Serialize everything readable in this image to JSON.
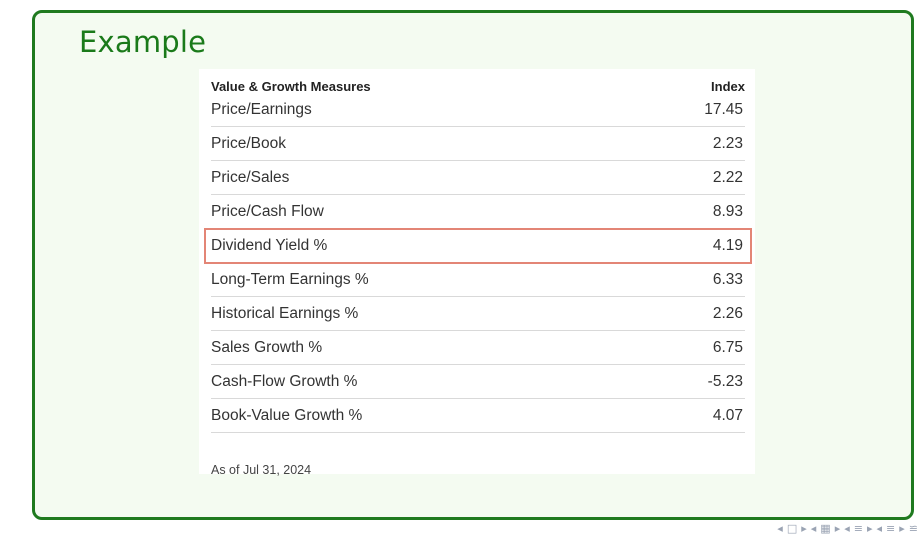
{
  "slide": {
    "title": "Example"
  },
  "table": {
    "header": {
      "label": "Value & Growth Measures",
      "value": "Index"
    },
    "rows": [
      {
        "label": "Price/Earnings",
        "value": "17.45"
      },
      {
        "label": "Price/Book",
        "value": "2.23"
      },
      {
        "label": "Price/Sales",
        "value": "2.22"
      },
      {
        "label": "Price/Cash Flow",
        "value": "8.93"
      },
      {
        "label": "Dividend Yield %",
        "value": "4.19"
      },
      {
        "label": "Long-Term Earnings %",
        "value": "6.33"
      },
      {
        "label": "Historical Earnings %",
        "value": "2.26"
      },
      {
        "label": "Sales Growth %",
        "value": "6.75"
      },
      {
        "label": "Cash-Flow Growth %",
        "value": "-5.23"
      },
      {
        "label": "Book-Value Growth %",
        "value": "4.07"
      }
    ],
    "highlighted_row": "Dividend Yield %",
    "footnote": "As of Jul 31, 2024"
  },
  "nav": {
    "icons": [
      "nav-prev-icon",
      "frame-icon",
      "nav-next-icon",
      "nav-prev-icon",
      "subsection-icon",
      "nav-next-icon",
      "nav-prev-icon",
      "section-icon",
      "nav-next-icon",
      "nav-prev-icon",
      "outline-icon",
      "nav-next-icon",
      "align-icon"
    ]
  },
  "colors": {
    "frame_border": "#1f7a1f",
    "frame_background": "#f4fbf1",
    "title": "#1a7a1a",
    "highlight_outline": "#e38576"
  }
}
